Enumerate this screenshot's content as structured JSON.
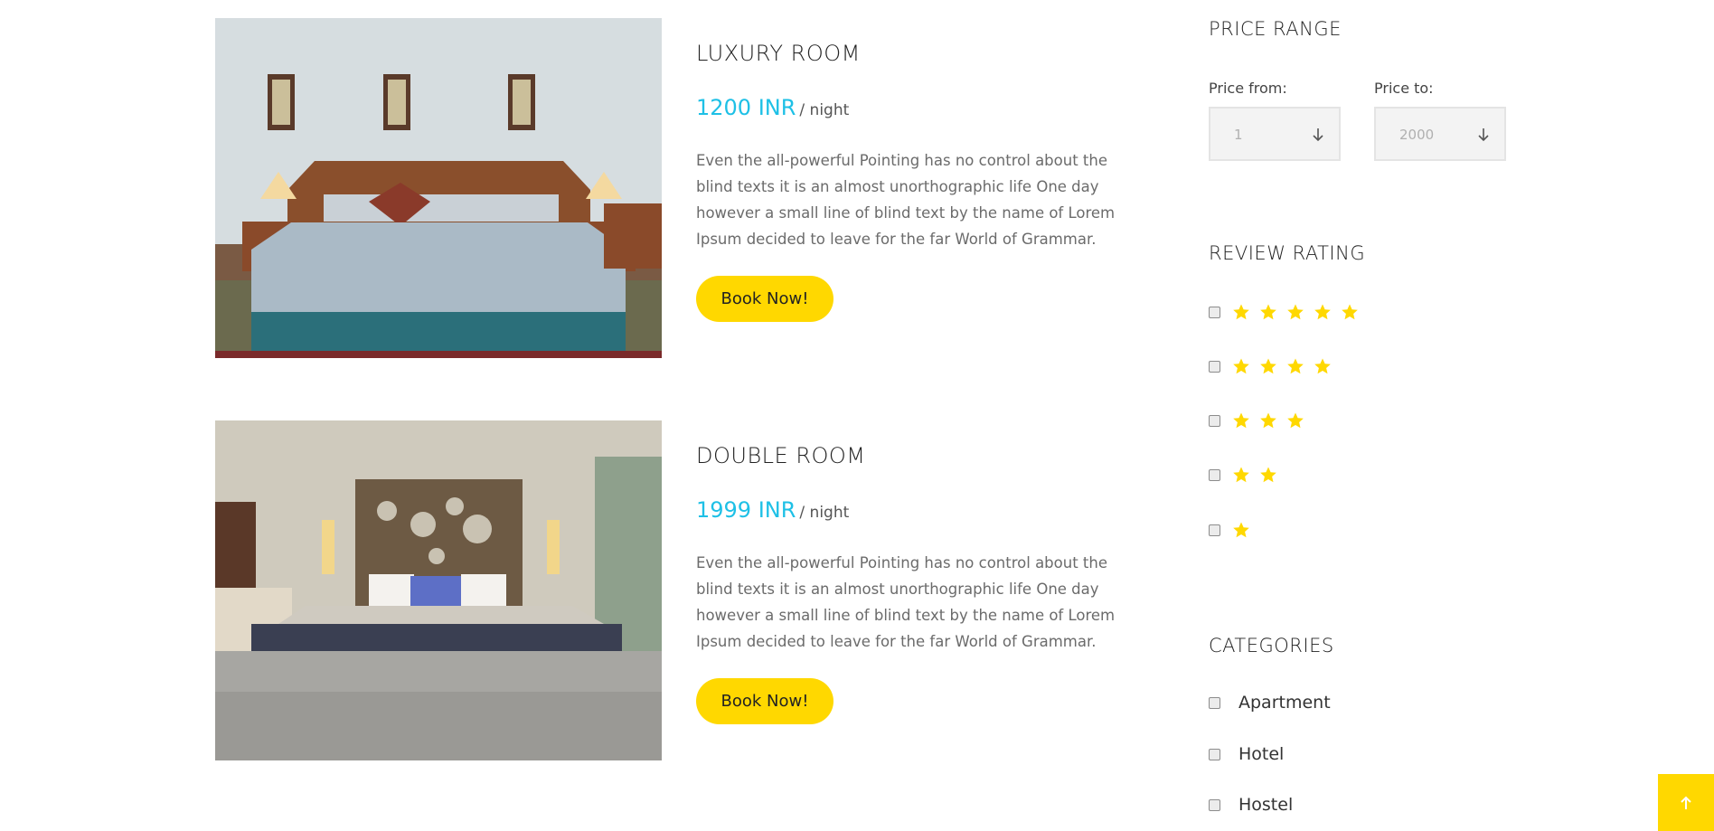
{
  "rooms": [
    {
      "title": "LUXURY ROOM",
      "price": "1200 INR",
      "price_unit": "/ night",
      "description": "Even the all-powerful Pointing has no control about the blind texts it is an almost unorthographic life One day however a small line of blind text by the name of Lorem Ipsum decided to leave for the far World of Grammar.",
      "book_label": "Book Now!"
    },
    {
      "title": "DOUBLE ROOM",
      "price": "1999 INR",
      "price_unit": "/ night",
      "description": "Even the all-powerful Pointing has no control about the blind texts it is an almost unorthographic life One day however a small line of blind text by the name of Lorem Ipsum decided to leave for the far World of Grammar.",
      "book_label": "Book Now!"
    }
  ],
  "sidebar": {
    "price_range": {
      "heading": "PRICE RANGE",
      "from_label": "Price from:",
      "from_value": "1",
      "to_label": "Price to:",
      "to_value": "2000"
    },
    "review_rating": {
      "heading": "REVIEW RATING",
      "options": [
        5,
        4,
        3,
        2,
        1
      ]
    },
    "categories": {
      "heading": "CATEGORIES",
      "items": [
        "Apartment",
        "Hotel",
        "Hostel"
      ]
    }
  },
  "icons": {
    "rating_star": "star-icon",
    "select_arrow": "arrow-down-icon",
    "back_to_top": "arrow-up-icon"
  },
  "colors": {
    "accent_yellow": "#ffd800",
    "price_blue": "#1ec0e6"
  }
}
